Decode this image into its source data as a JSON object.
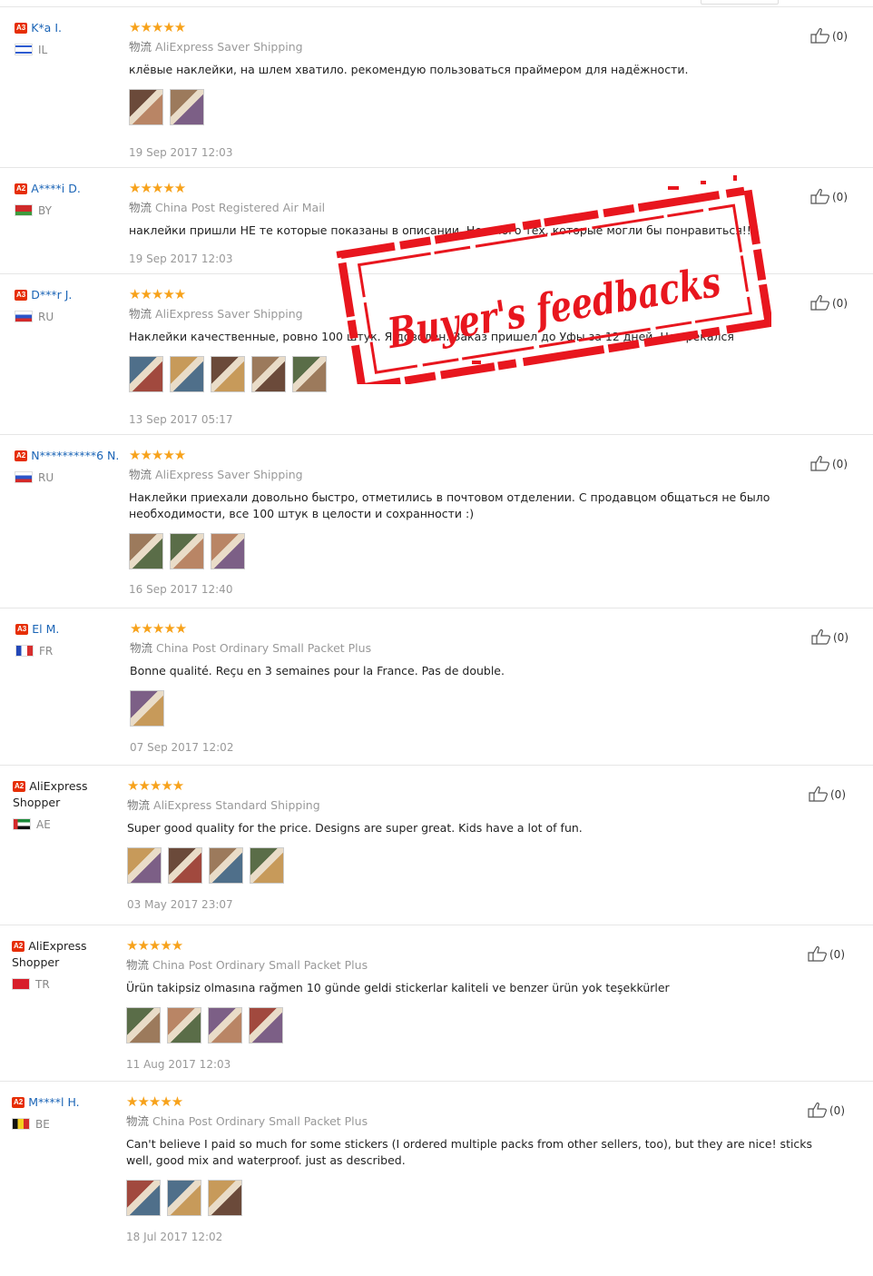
{
  "reviews": [
    {
      "level": "A3",
      "name": "K*a I.",
      "country": "IL",
      "shipping": "AliExpress Saver Shipping",
      "text": "клёвые наклейки, на шлем хватило. рекомендую пользоваться праймером для надёжности.",
      "date": "19 Sep 2017 12:03",
      "likes": "(0)",
      "photos": 2,
      "flag": "il"
    },
    {
      "level": "A2",
      "name": "A****i D.",
      "country": "BY",
      "shipping": "China Post Registered Air Mail",
      "text": "наклейки пришли НЕ те которые показаны в описании. Не много тех, которые могли бы понравиться!!!",
      "date": "19 Sep 2017 12:03",
      "likes": "(0)",
      "photos": 0,
      "flag": "by"
    },
    {
      "level": "A3",
      "name": "D***r J.",
      "country": "RU",
      "shipping": "AliExpress Saver Shipping",
      "text": "Наклейки качественные, ровно 100 штук. Я доволен. Заказ пришел до Уфы за 12 дней. Не трекался",
      "date": "13 Sep 2017 05:17",
      "likes": "(0)",
      "photos": 5,
      "flag": "ru"
    },
    {
      "level": "A2",
      "name": "N**********6 N.",
      "country": "RU",
      "shipping": "AliExpress Saver Shipping",
      "text": "Наклейки приехали довольно быстро, отметились в почтовом отделении. С продавцом общаться не было необходимости, все 100 штук в целости и сохранности :)",
      "date": "16 Sep 2017 12:40",
      "likes": "(0)",
      "photos": 3,
      "flag": "ru"
    },
    {
      "level": "A3",
      "name": "El M.",
      "country": "FR",
      "shipping": "China Post Ordinary Small Packet Plus",
      "text": "Bonne qualité. Reçu en 3 semaines pour la France. Pas de double.",
      "date": "07 Sep 2017 12:02",
      "likes": "(0)",
      "photos": 1,
      "flag": "fr"
    },
    {
      "level": "A2",
      "name": "AliExpress Shopper",
      "country": "AE",
      "shipping": "AliExpress Standard Shipping",
      "text": "Super good quality for the price. Designs are super great. Kids have a lot of fun.",
      "date": "03 May 2017 23:07",
      "likes": "(0)",
      "photos": 4,
      "flag": "ae"
    },
    {
      "level": "A2",
      "name": "AliExpress Shopper",
      "country": "TR",
      "shipping": "China Post Ordinary Small Packet Plus",
      "text": "Ürün takipsiz olmasına rağmen 10 günde geldi stickerlar kaliteli ve benzer ürün yok teşekkürler",
      "date": "11 Aug 2017 12:03",
      "likes": "(0)",
      "photos": 4,
      "flag": "tr"
    },
    {
      "level": "A2",
      "name": "M****l H.",
      "country": "BE",
      "shipping": "China Post Ordinary Small Packet Plus",
      "text": "Can't believe I paid so much for some stickers (I ordered multiple packs from other sellers, too), but they are nice! sticks well, good mix and waterproof. just as described.",
      "date": "18 Jul 2017 12:02",
      "likes": "(0)",
      "photos": 3,
      "flag": "be"
    }
  ],
  "shipping_prefix": "物流",
  "stars": "★★★★★",
  "stamp_text": "Buyer's feedbacks",
  "colors": {
    "link": "#1a64b6",
    "star": "#f7a21b",
    "level_badge": "#e62e04",
    "stamp": "#e8161e"
  }
}
